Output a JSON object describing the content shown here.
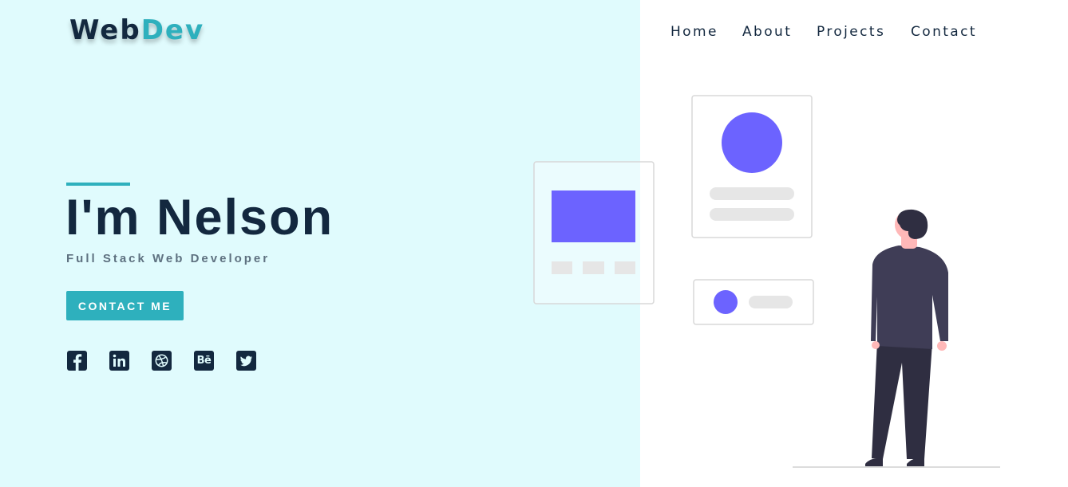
{
  "brand": {
    "part1": "Web",
    "part2": "Dev"
  },
  "nav": {
    "items": [
      "Home",
      "About",
      "Projects",
      "Contact"
    ]
  },
  "hero": {
    "headline": "I'm Nelson",
    "subtitle": "Full Stack Web Developer",
    "cta_label": "CONTACT ME"
  },
  "socials": [
    {
      "icon": "facebook-icon"
    },
    {
      "icon": "linkedin-icon"
    },
    {
      "icon": "dribbble-icon"
    },
    {
      "icon": "behance-icon",
      "text": "Bē"
    },
    {
      "icon": "twitter-icon"
    }
  ],
  "colors": {
    "left_background": "#e0fbfd",
    "accent": "#2eb0bd",
    "navy": "#13283f",
    "illustration_purple": "#6c63ff"
  }
}
